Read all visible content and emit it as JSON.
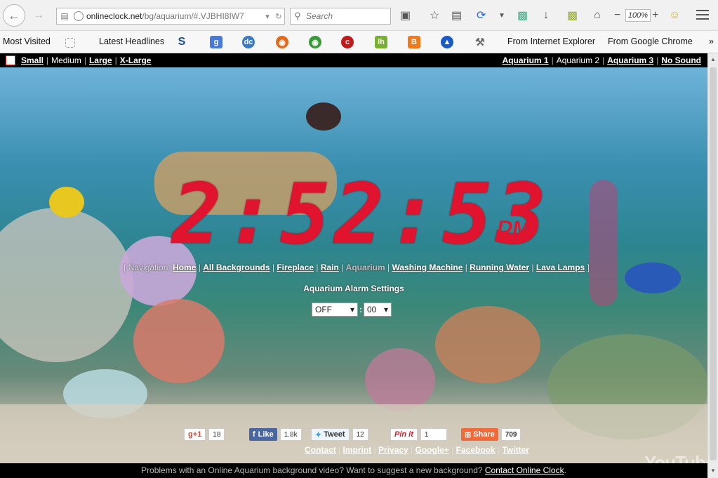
{
  "browser": {
    "url_main": "onlineclock.net",
    "url_path": "/bg/aquarium/#.VJBHI8IW7",
    "search_placeholder": "Search",
    "zoom": "100%"
  },
  "bookmarks": [
    "Most Visited",
    "Latest Headlines",
    "From Internet Explorer",
    "From Google Chrome"
  ],
  "site": {
    "sizes": [
      "Small",
      "Medium",
      "Large",
      "X-Large"
    ],
    "aquaria": [
      "Aquarium 1",
      "Aquarium 2",
      "Aquarium 3",
      "No Sound"
    ],
    "clock_time": "2:52:53",
    "clock_ampm": "PM",
    "nav_label": "[ Navigation:",
    "nav_links": [
      "Home",
      "All Backgrounds",
      "Fireplace",
      "Rain",
      "Aquarium",
      "Washing Machine",
      "Running Water",
      "Lava Lamps"
    ],
    "nav_end": "]",
    "alarm_title": "Aquarium Alarm Settings",
    "alarm_hour": "OFF",
    "alarm_minute": "00",
    "social": {
      "gplus": "g+1",
      "gplus_count": "18",
      "like": "Like",
      "like_count": "1.8k",
      "tweet": "Tweet",
      "tweet_count": "12",
      "pinit": "Pin it",
      "pin_count": "1",
      "share": "Share",
      "share_count": "709"
    },
    "footer_links": [
      "Contact",
      "Imprint",
      "Privacy",
      "Google+",
      "Facebook",
      "Twitter"
    ],
    "bottom_text": "Problems with an Online Aquarium background video? Want to suggest a new background?",
    "bottom_link": "Contact Online Clock",
    "bottom_end": ".",
    "youtube": "YouTube"
  }
}
